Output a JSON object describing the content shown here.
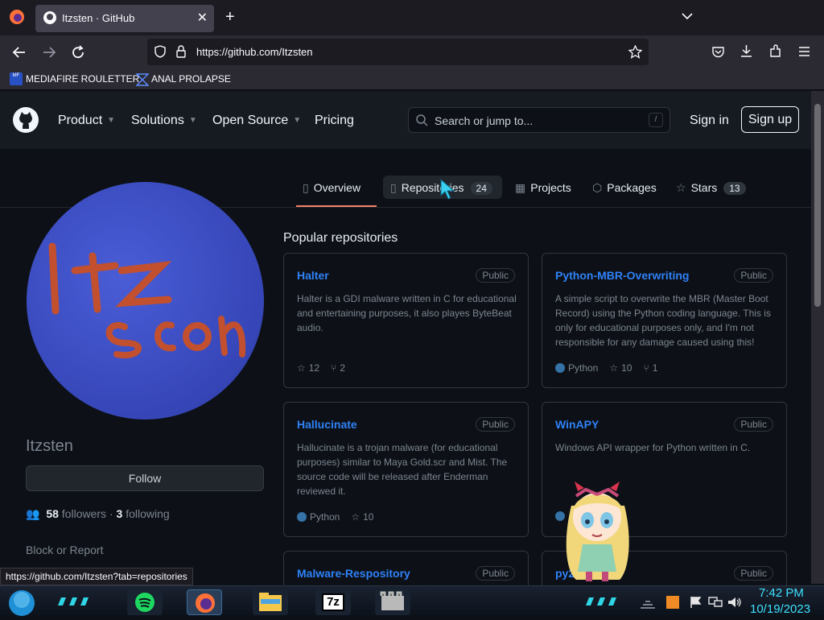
{
  "browser": {
    "tab_title": "Itzsten · GitHub",
    "url": "https://github.com/Itzsten",
    "bookmarks": [
      {
        "label": "MEDIAFIRE ROULETTER"
      },
      {
        "label": "ANAL PROLAPSE"
      }
    ],
    "bookmark_badge": "MF"
  },
  "header": {
    "nav": [
      "Product",
      "Solutions",
      "Open Source",
      "Pricing"
    ],
    "search_placeholder": "Search or jump to...",
    "search_key": "/",
    "sign_in": "Sign in",
    "sign_up": "Sign up"
  },
  "profile_tabs": [
    {
      "label": "Overview",
      "count": null,
      "icon": "book-icon"
    },
    {
      "label": "Repositories",
      "count": "24",
      "icon": "repo-icon"
    },
    {
      "label": "Projects",
      "count": null,
      "icon": "table-icon"
    },
    {
      "label": "Packages",
      "count": null,
      "icon": "package-icon"
    },
    {
      "label": "Stars",
      "count": "13",
      "icon": "star-icon"
    }
  ],
  "sidebar": {
    "username": "Itzsten",
    "follow_label": "Follow",
    "followers_count": "58",
    "followers_label": "followers",
    "separator": "·",
    "following_count": "3",
    "following_label": "following",
    "block_label": "Block or Report"
  },
  "repos": {
    "heading": "Popular repositories",
    "items": [
      {
        "name": "Halter",
        "visibility": "Public",
        "description": "Halter is a GDI malware written in C for educational and entertaining purposes, it also playes ByteBeat audio.",
        "language": "",
        "stars": "12",
        "forks": "2"
      },
      {
        "name": "Python-MBR-Overwriting",
        "visibility": "Public",
        "description": "A simple script to overwrite the MBR (Master Boot Record) using the Python coding language. This is only for educational purposes only, and I'm not responsible for any damage caused using this!",
        "language": "Python",
        "stars": "10",
        "forks": "1"
      },
      {
        "name": "Hallucinate",
        "visibility": "Public",
        "description": "Hallucinate is a trojan malware (for educational purposes) similar to Maya Gold.scr and Mist. The source code will be released after Enderman reviewed it.",
        "language": "Python",
        "stars": "10",
        "forks": ""
      },
      {
        "name": "WinAPY",
        "visibility": "Public",
        "description": "Windows API wrapper for Python written in C.",
        "language": "",
        "stars": "",
        "forks": ""
      },
      {
        "name": "Malware-Respository",
        "visibility": "Public",
        "description": "",
        "language": "",
        "stars": "",
        "forks": ""
      },
      {
        "name": "py2",
        "visibility": "Public",
        "description": "",
        "language": "",
        "stars": "",
        "forks": ""
      }
    ]
  },
  "status_url": "https://github.com/Itzsten?tab=repositories",
  "taskbar": {
    "time": "7:42 PM",
    "date": "10/19/2023",
    "sevenzip_label": "7z"
  },
  "colors": {
    "accent_link": "#2f81f7",
    "tab_underline": "#f78166",
    "python_dot": "#3572a5",
    "clock": "#3ee0ff"
  }
}
